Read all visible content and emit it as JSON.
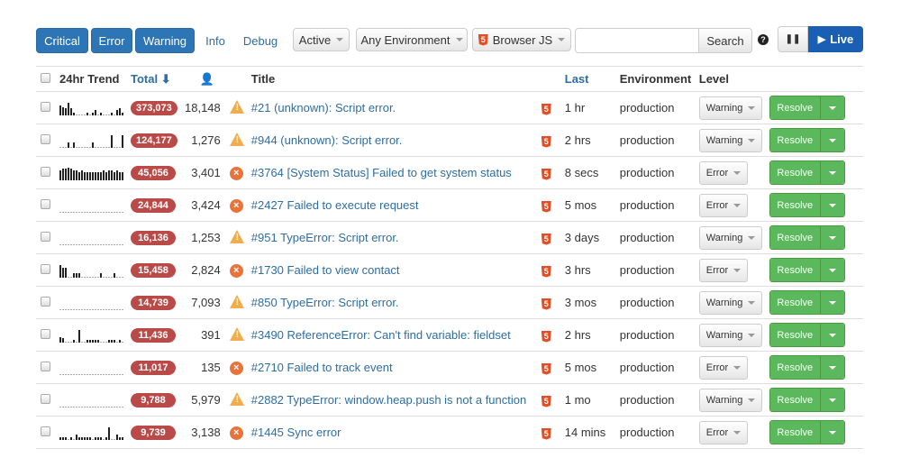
{
  "toolbar": {
    "levels": [
      {
        "label": "Critical",
        "active": true
      },
      {
        "label": "Error",
        "active": true
      },
      {
        "label": "Warning",
        "active": true
      },
      {
        "label": "Info",
        "active": false
      },
      {
        "label": "Debug",
        "active": false
      }
    ],
    "status_filter": "Active",
    "environment_filter": "Any Environment",
    "platform_filter": "Browser JS",
    "search_value": "",
    "search_label": "Search",
    "help_icon": "question-circle-icon",
    "pause_icon": "pause-icon",
    "live_label": "Live"
  },
  "table": {
    "headers": {
      "trend": "24hr Trend",
      "total": "Total",
      "users_icon": "user-icon",
      "title": "Title",
      "last": "Last",
      "environment": "Environment",
      "level": "Level"
    },
    "rows": [
      {
        "trend": [
          6,
          5,
          4,
          8,
          4,
          1,
          0,
          0,
          0,
          0,
          1,
          0,
          1,
          3,
          0,
          1,
          0,
          0,
          0,
          1,
          0,
          3,
          4,
          1
        ],
        "total": "373,073",
        "users": "18,148",
        "type": "warning",
        "title": "#21 (unknown): Script error.",
        "last": "1 hr",
        "env": "production",
        "level": "Warning"
      },
      {
        "trend": [
          0,
          0,
          0,
          3,
          0,
          3,
          0,
          0,
          0,
          0,
          0,
          0,
          3,
          0,
          0,
          0,
          0,
          0,
          0,
          8,
          0,
          0,
          0,
          8
        ],
        "total": "124,177",
        "users": "1,276",
        "type": "warning",
        "title": "#944 (unknown): Script error.",
        "last": "2 hrs",
        "env": "production",
        "level": "Warning"
      },
      {
        "trend": [
          6,
          7,
          7,
          8,
          7,
          6,
          6,
          5,
          6,
          5,
          5,
          5,
          5,
          5,
          5,
          5,
          6,
          5,
          6,
          6,
          5,
          6,
          5,
          5
        ],
        "total": "45,056",
        "users": "3,401",
        "type": "error",
        "title": "#3764 [System Status] Failed to get system status",
        "last": "8 secs",
        "env": "production",
        "level": "Error"
      },
      {
        "trend": [
          0,
          0,
          0,
          0,
          0,
          0,
          0,
          0,
          0,
          0,
          0,
          0,
          0,
          0,
          0,
          0,
          0,
          0,
          0,
          0,
          0,
          0,
          0,
          0
        ],
        "total": "24,844",
        "users": "3,424",
        "type": "error",
        "title": "#2427 Failed to execute request",
        "last": "5 mos",
        "env": "production",
        "level": "Error"
      },
      {
        "trend": [
          0,
          0,
          0,
          0,
          0,
          0,
          0,
          0,
          0,
          0,
          0,
          0,
          0,
          0,
          0,
          0,
          0,
          0,
          0,
          0,
          0,
          0,
          0,
          0
        ],
        "total": "16,136",
        "users": "1,253",
        "type": "warning",
        "title": "#951 TypeError: Script error.",
        "last": "3 days",
        "env": "production",
        "level": "Warning"
      },
      {
        "trend": [
          8,
          6,
          6,
          0,
          0,
          2,
          2,
          2,
          0,
          0,
          0,
          0,
          0,
          0,
          0,
          2,
          0,
          0,
          0,
          0,
          2,
          0,
          0,
          0
        ],
        "total": "15,458",
        "users": "2,824",
        "type": "error",
        "title": "#1730 Failed to view contact",
        "last": "3 hrs",
        "env": "production",
        "level": "Error"
      },
      {
        "trend": [
          0,
          0,
          0,
          0,
          0,
          0,
          0,
          0,
          0,
          0,
          0,
          0,
          0,
          0,
          0,
          0,
          0,
          0,
          0,
          0,
          0,
          0,
          0,
          0
        ],
        "total": "14,739",
        "users": "7,093",
        "type": "warning",
        "title": "#850 TypeError: Script error.",
        "last": "3 mos",
        "env": "production",
        "level": "Warning"
      },
      {
        "trend": [
          3,
          2,
          0,
          0,
          0,
          1,
          0,
          8,
          0,
          0,
          1,
          1,
          1,
          1,
          1,
          0,
          0,
          0,
          1,
          1,
          1,
          0,
          1,
          0
        ],
        "total": "11,436",
        "users": "391",
        "type": "warning",
        "title": "#3490 ReferenceError: Can't find variable: fieldset",
        "last": "2 hrs",
        "env": "production",
        "level": "Warning"
      },
      {
        "trend": [
          0,
          0,
          0,
          0,
          0,
          0,
          0,
          0,
          0,
          0,
          0,
          0,
          0,
          0,
          0,
          0,
          0,
          0,
          0,
          0,
          0,
          0,
          0,
          0
        ],
        "total": "11,017",
        "users": "135",
        "type": "error",
        "title": "#2710 Failed to track event",
        "last": "5 mos",
        "env": "production",
        "level": "Error"
      },
      {
        "trend": [
          0,
          0,
          0,
          0,
          0,
          0,
          0,
          0,
          0,
          0,
          0,
          0,
          0,
          0,
          0,
          0,
          0,
          0,
          0,
          0,
          0,
          0,
          0,
          0
        ],
        "total": "9,788",
        "users": "5,979",
        "type": "warning",
        "title": "#2882 TypeError: window.heap.push is not a function",
        "last": "1 mo",
        "env": "production",
        "level": "Warning"
      },
      {
        "trend": [
          1,
          1,
          1,
          0,
          1,
          0,
          3,
          1,
          1,
          1,
          1,
          1,
          0,
          1,
          1,
          1,
          0,
          1,
          8,
          0,
          0,
          3,
          1,
          1
        ],
        "total": "9,739",
        "users": "3,138",
        "type": "error",
        "title": "#1445 Sync error",
        "last": "14 mins",
        "env": "production",
        "level": "Error"
      }
    ]
  },
  "resolve_label": "Resolve",
  "colors": {
    "primary": "#2e75b5",
    "badge": "#b94a48",
    "resolve": "#5cb85c",
    "warning": "#f0ad4e",
    "error": "#e8743b",
    "html5": "#e44d26"
  }
}
